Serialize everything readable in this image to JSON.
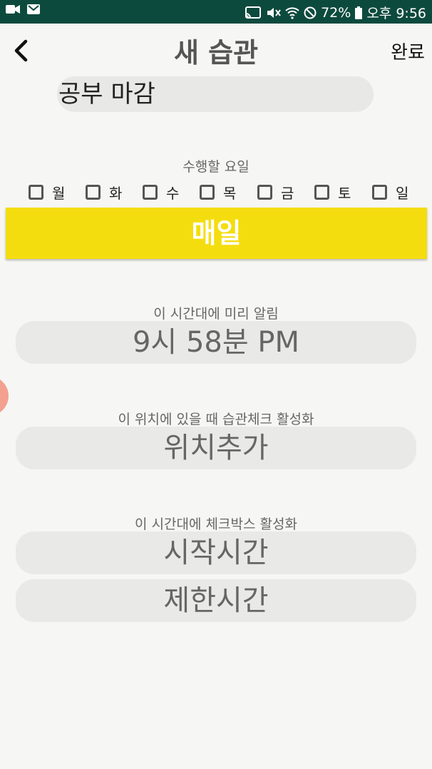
{
  "status_bar": {
    "battery": "72%",
    "time": "오후 9:56",
    "colors": {
      "background": "#0d4a3e",
      "text": "#ffffff"
    },
    "left_icons": [
      "video-camera-icon",
      "mail-icon"
    ],
    "right_icons": [
      "cast-icon",
      "vibrate-mute-icon",
      "wifi-icon",
      "do-not-disturb-icon",
      "battery-icon"
    ]
  },
  "header": {
    "title": "새 습관",
    "done_label": "완료",
    "back_icon": "chevron-left-icon"
  },
  "habit": {
    "name": "공부 마감"
  },
  "days_section": {
    "label": "수행할 요일",
    "days": [
      {
        "label": "월",
        "checked": false
      },
      {
        "label": "화",
        "checked": false
      },
      {
        "label": "수",
        "checked": false
      },
      {
        "label": "목",
        "checked": false
      },
      {
        "label": "금",
        "checked": false
      },
      {
        "label": "토",
        "checked": false
      },
      {
        "label": "일",
        "checked": false
      }
    ],
    "everyday_label": "매일",
    "everyday_color": "#f4dd0f"
  },
  "reminder_section": {
    "label": "이 시간대에 미리 알림",
    "time_value": "9시 58분 PM"
  },
  "location_section": {
    "label": "이 위치에 있을 때 습관체크 활성화",
    "add_location_label": "위치추가"
  },
  "checkbox_time_section": {
    "label": "이 시간대에 체크박스 활성화",
    "start_label": "시작시간",
    "limit_label": "제한시간"
  }
}
